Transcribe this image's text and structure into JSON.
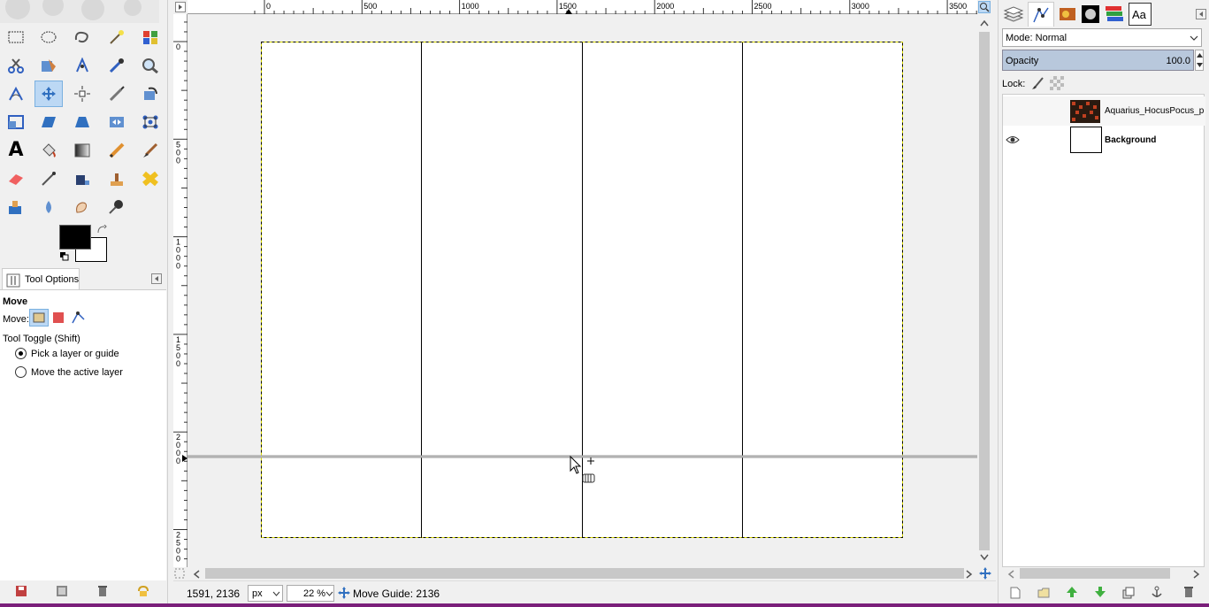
{
  "tools": [
    "rect-select",
    "ellipse-select",
    "free-select",
    "fuzzy-select",
    "select-by-color",
    "scissors-select",
    "foreground-select",
    "paths",
    "color-picker",
    "zoom",
    "measure",
    "move",
    "align",
    "crop",
    "rotate",
    "scale",
    "shear",
    "perspective",
    "flip",
    "cage-transform",
    "text",
    "bucket-fill",
    "blend",
    "pencil",
    "paintbrush",
    "eraser",
    "airbrush",
    "ink",
    "clone",
    "heal",
    "perspective-clone",
    "blur",
    "smudge",
    "dodge-burn"
  ],
  "tool_options": {
    "tab_label": "Tool Options",
    "heading": "Move",
    "move_label": "Move:",
    "toggle_label": "Tool Toggle  (Shift)",
    "option1": "Pick a layer or guide",
    "option2": "Move the active layer"
  },
  "ruler": {
    "h_ticks": [
      "0",
      "500",
      "1000",
      "1500",
      "2000",
      "2500",
      "3000",
      "3500"
    ],
    "v_ticks": [
      "0",
      "5\n0\n0",
      "1\n0\n0\n0",
      "1\n5\n0\n0",
      "2\n0\n0\n0",
      "2\n5\n0\n0"
    ]
  },
  "status": {
    "coords": "1591, 2136",
    "unit": "px",
    "zoom": "22 %",
    "message": "Move Guide: 2136"
  },
  "layers_panel": {
    "mode_label": "Mode: Normal",
    "opacity_label": "Opacity",
    "opacity_value": "100.0",
    "lock_label": "Lock:",
    "layers": [
      {
        "name": "Aquarius_HocusPocus_pp",
        "visible": false,
        "bold": false
      },
      {
        "name": "Background",
        "visible": true,
        "bold": true
      }
    ]
  },
  "colors": {
    "accent": "#7ab0e0",
    "guide": "#000000",
    "selection": "#e0e000",
    "taskbar": "#7a1f7a"
  }
}
